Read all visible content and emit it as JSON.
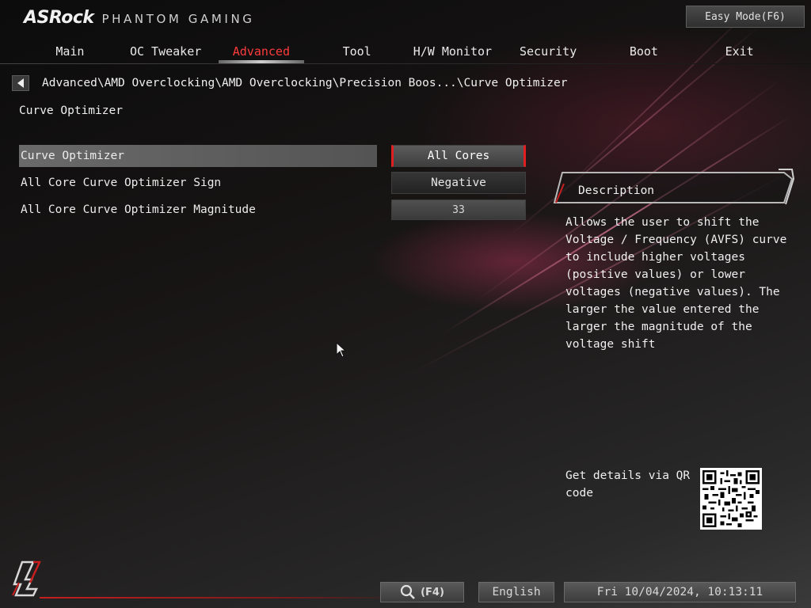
{
  "header": {
    "brand": "ASRock",
    "product_line": "PHANTOM GAMING",
    "easy_mode_label": "Easy Mode(F6)"
  },
  "tabs": [
    {
      "label": "Main",
      "active": false
    },
    {
      "label": "OC Tweaker",
      "active": false
    },
    {
      "label": "Advanced",
      "active": true
    },
    {
      "label": "Tool",
      "active": false
    },
    {
      "label": "H/W Monitor",
      "active": false
    },
    {
      "label": "Security",
      "active": false
    },
    {
      "label": "Boot",
      "active": false
    },
    {
      "label": "Exit",
      "active": false
    }
  ],
  "breadcrumb": "Advanced\\AMD Overclocking\\AMD Overclocking\\Precision Boos...\\Curve Optimizer",
  "section_title": "Curve Optimizer",
  "settings": [
    {
      "label": "Curve Optimizer",
      "value": "All Cores"
    },
    {
      "label": "All Core Curve Optimizer Sign",
      "value": "Negative"
    },
    {
      "label": "All Core Curve Optimizer Magnitude",
      "value": "33"
    }
  ],
  "description": {
    "title": "Description",
    "text": "Allows the user to shift the\nVoltage / Frequency (AVFS) curve\nto include higher voltages\n(positive values) or lower\nvoltages (negative values). The\nlarger the value entered the\nlarger the magnitude of the\nvoltage shift"
  },
  "qr_text": "Get details via QR code",
  "footer": {
    "search_key": "(F4)",
    "language": "English",
    "datetime": "Fri 10/04/2024, 10:13:11"
  },
  "colors": {
    "accent": "#e02020",
    "active_tab": "#ff3b3b",
    "selected_row": "#5e5e5e"
  }
}
